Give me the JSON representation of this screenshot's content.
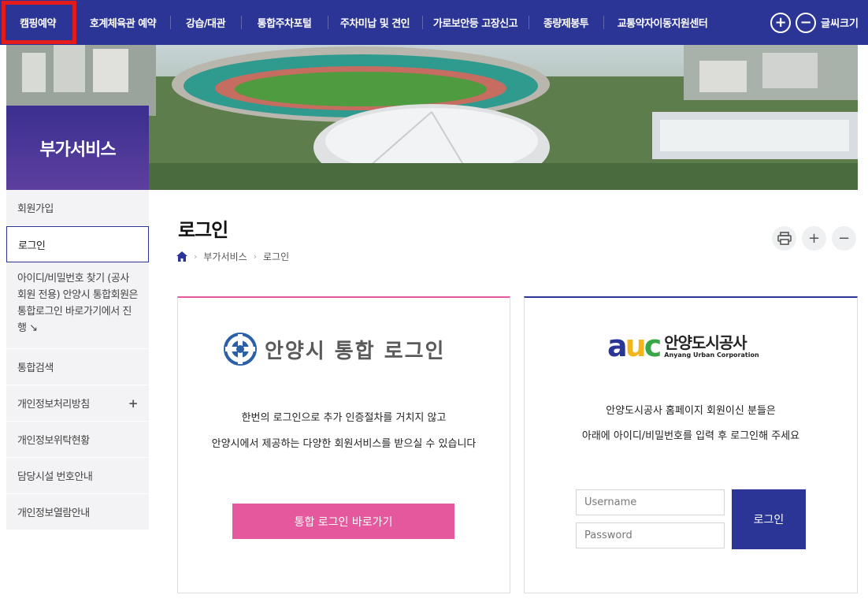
{
  "nav": {
    "items": [
      {
        "label": "캠핑예약",
        "width": 96
      },
      {
        "label": "호계체육관 예약",
        "width": 120
      },
      {
        "label": "강습/대관",
        "width": 90
      },
      {
        "label": "통합주차포털",
        "width": 110
      },
      {
        "label": "주차미납 및 견인",
        "width": 120
      },
      {
        "label": "가로보안등 고장신고",
        "width": 135
      },
      {
        "label": "종량제봉투",
        "width": 95
      },
      {
        "label": "교통약자이동지원센터",
        "width": 150
      }
    ],
    "font_size_label": "글씨크기",
    "plus_symbol": "+",
    "minus_symbol": "−"
  },
  "sidebar": {
    "title": "부가서비스",
    "items": [
      {
        "label": "회원가입"
      },
      {
        "label": "로그인"
      },
      {
        "label": "아이디/비밀번호 찾기 (공사회원 전용) 안양시 통합회원은 통합로그인 바로가기에서 진행 ↘"
      },
      {
        "label": "통합검색"
      },
      {
        "label": "개인정보처리방침",
        "toggle": "+"
      },
      {
        "label": "개인정보위탁현황"
      },
      {
        "label": "담당시설 번호안내"
      },
      {
        "label": "개인정보열람안내"
      }
    ]
  },
  "page": {
    "title": "로그인",
    "breadcrumb": [
      "부가서비스",
      "로그인"
    ],
    "breadcrumb_sep": "›"
  },
  "tools": {
    "plus": "+",
    "minus": "−"
  },
  "left_panel": {
    "logo_text": "안양시 통합 로그인",
    "desc_line1": "한번의 로그인으로 추가 인증절차를 거치지 않고",
    "desc_line2": "안양시에서 제공하는 다양한 회원서비스를 받으실 수 있습니다",
    "button": "통합 로그인 바로가기"
  },
  "right_panel": {
    "logo_name_kr": "안양도시공사",
    "logo_name_en": "Anyang Urban Corporation",
    "desc_line1": "안양도시공사 홈페이지 회원이신 분들은",
    "desc_line2": "아래에 아이디/비밀번호를 입력 후 로그인해 주세요",
    "username_placeholder": "Username",
    "password_placeholder": "Password",
    "login_button": "로그인"
  },
  "colors": {
    "nav_bg": "#2b3595",
    "accent_pink": "#e6589e",
    "highlight_red": "#e41b1b"
  }
}
